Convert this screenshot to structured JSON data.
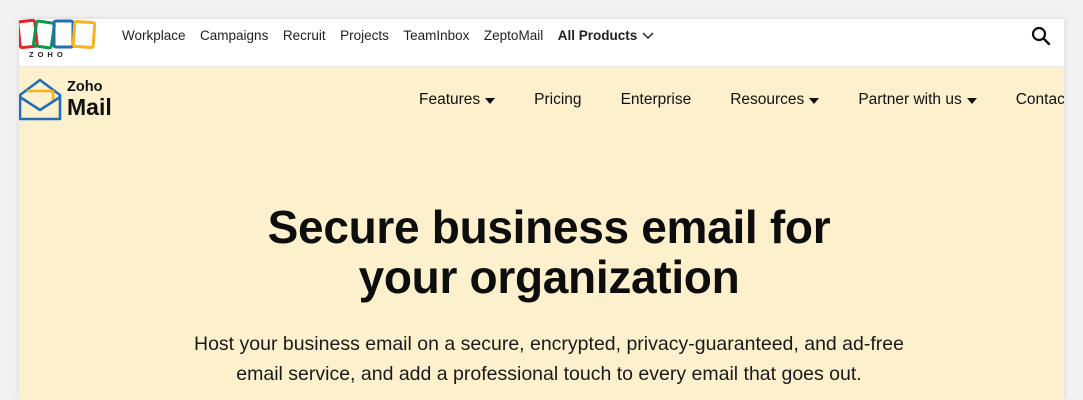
{
  "topbar": {
    "logo_text": "ZOHO",
    "links": [
      "Workplace",
      "Campaigns",
      "Recruit",
      "Projects",
      "TeamInbox",
      "ZeptoMail"
    ],
    "all_products": "All Products",
    "search_icon": "search-icon"
  },
  "brand": {
    "zoho": "Zoho",
    "mail": "Mail",
    "icon": "envelope-icon"
  },
  "nav": {
    "features": "Features",
    "pricing": "Pricing",
    "enterprise": "Enterprise",
    "resources": "Resources",
    "partner": "Partner with us",
    "contact": "Contact Us"
  },
  "hero": {
    "title_line1": "Secure business email for",
    "title_line2": "your organization",
    "subtitle_line1": "Host your business email on a secure, encrypted, privacy-guaranteed, and ad-free",
    "subtitle_line2": "email service, and add a professional touch to every email that goes out."
  },
  "colors": {
    "background": "#fdf0cc",
    "topbar": "#ffffff",
    "zoho_red": "#e42527",
    "zoho_green": "#089949",
    "zoho_blue": "#226db4",
    "zoho_yellow": "#f9b21d"
  }
}
